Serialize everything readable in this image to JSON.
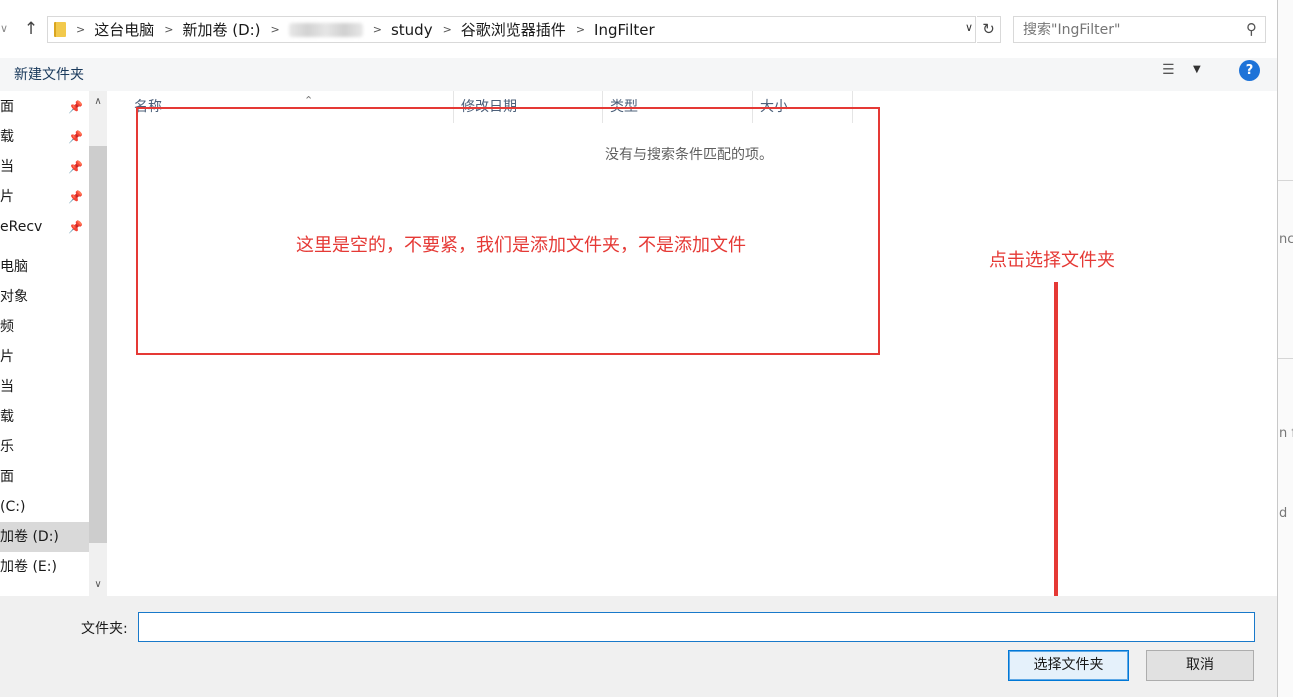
{
  "address": {
    "crumbs": [
      "这台电脑",
      "新加卷 (D:)",
      "study",
      "谷歌浏览器插件",
      "IngFilter"
    ]
  },
  "search": {
    "placeholder": "搜索\"IngFilter\""
  },
  "toolbar": {
    "new_folder": "新建文件夹",
    "help": "?"
  },
  "nav": {
    "items": [
      {
        "label": "面",
        "pinned": true
      },
      {
        "label": "载",
        "pinned": true
      },
      {
        "label": "当",
        "pinned": true
      },
      {
        "label": "片",
        "pinned": true
      },
      {
        "label": "eRecv",
        "pinned": true
      },
      {
        "label": "电脑",
        "pinned": false
      },
      {
        "label": " 对象",
        "pinned": false
      },
      {
        "label": "频",
        "pinned": false
      },
      {
        "label": "片",
        "pinned": false
      },
      {
        "label": "当",
        "pinned": false
      },
      {
        "label": "载",
        "pinned": false
      },
      {
        "label": "乐",
        "pinned": false
      },
      {
        "label": "面",
        "pinned": false
      },
      {
        "label": " (C:)",
        "pinned": false
      },
      {
        "label": "加卷 (D:)",
        "pinned": false,
        "selected": true
      },
      {
        "label": "加卷 (E:)",
        "pinned": false
      }
    ]
  },
  "columns": [
    "名称",
    "修改日期",
    "类型",
    "大小"
  ],
  "empty_message": "没有与搜索条件匹配的项。",
  "annotations": {
    "box_note": "这里是空的，不要紧，我们是添加文件夹，不是添加文件",
    "arrow_note": "点击选择文件夹"
  },
  "bottom": {
    "folder_label": "文件夹:",
    "folder_value": "",
    "select_button": "选择文件夹",
    "cancel_button": "取消"
  },
  "right_strip": [
    "nc",
    "n f",
    "d"
  ],
  "colors": {
    "annotation": "#e53935",
    "accent": "#0078d7"
  }
}
